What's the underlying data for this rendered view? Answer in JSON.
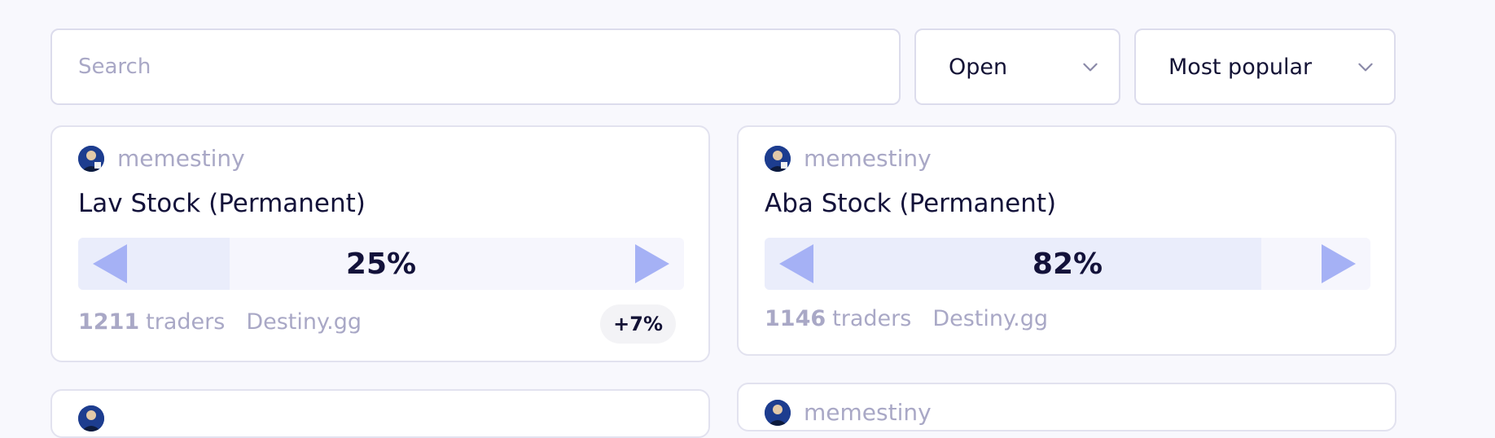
{
  "search": {
    "placeholder": "Search",
    "value": ""
  },
  "filters": {
    "status": {
      "selected": "Open"
    },
    "sort": {
      "selected": "Most popular"
    }
  },
  "markets": [
    {
      "creator": "memestiny",
      "title": "Lav Stock (Permanent)",
      "probability_label": "25%",
      "probability": 0.25,
      "traders_count": "1211",
      "traders_label": "traders",
      "group": "Destiny.gg",
      "change": "+7%"
    },
    {
      "creator": "memestiny",
      "title": "Aba Stock (Permanent)",
      "probability_label": "82%",
      "probability": 0.82,
      "traders_count": "1146",
      "traders_label": "traders",
      "group": "Destiny.gg"
    },
    {
      "creator": ""
    },
    {
      "creator": "memestiny"
    }
  ],
  "colors": {
    "accent": "#a5b1f5",
    "bar_fill": "#eaedfb",
    "muted_text": "#a9a8c6",
    "title_text": "#13123a"
  }
}
